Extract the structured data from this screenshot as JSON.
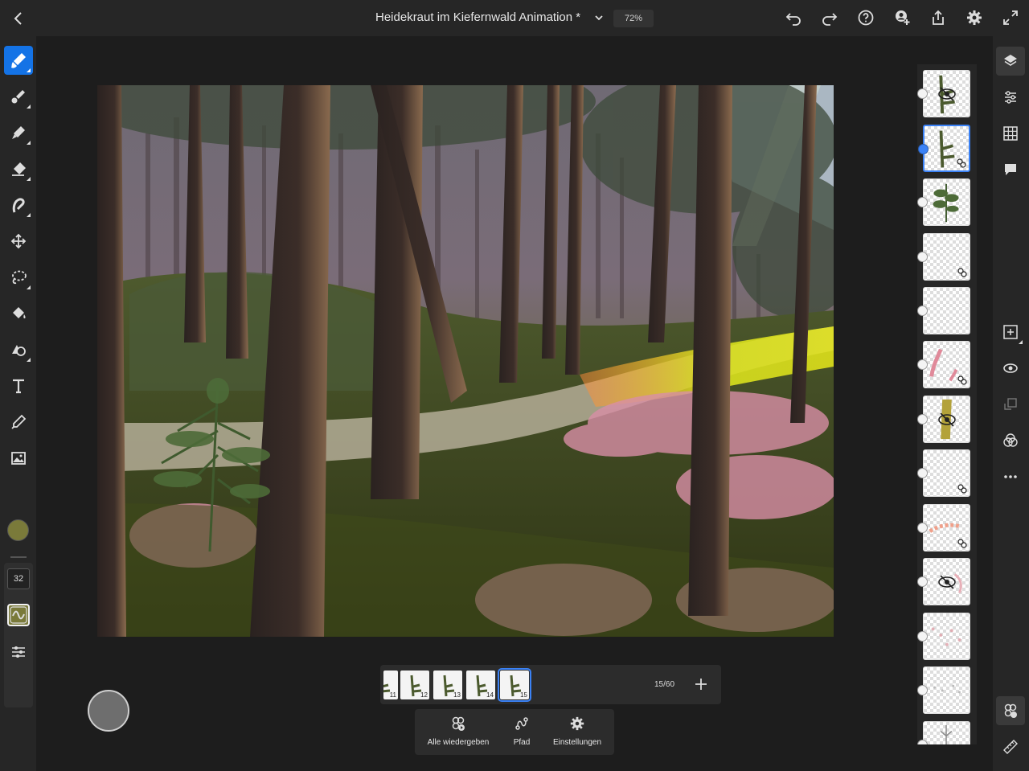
{
  "header": {
    "title": "Heidekraut im Kiefernwald Animation *",
    "zoom": "72%"
  },
  "toolbar_left": {
    "brush_size": "32",
    "color": "#7a7a3a"
  },
  "timeline": {
    "frames": [
      "11",
      "12",
      "13",
      "14",
      "15"
    ],
    "active_frame": "15",
    "counter": "15/60"
  },
  "animation_bar": {
    "play_all": "Alle wiedergeben",
    "path": "Pfad",
    "settings": "Einstellungen"
  },
  "colors": {
    "accent": "#1473e6",
    "selection": "#3b82f6"
  }
}
